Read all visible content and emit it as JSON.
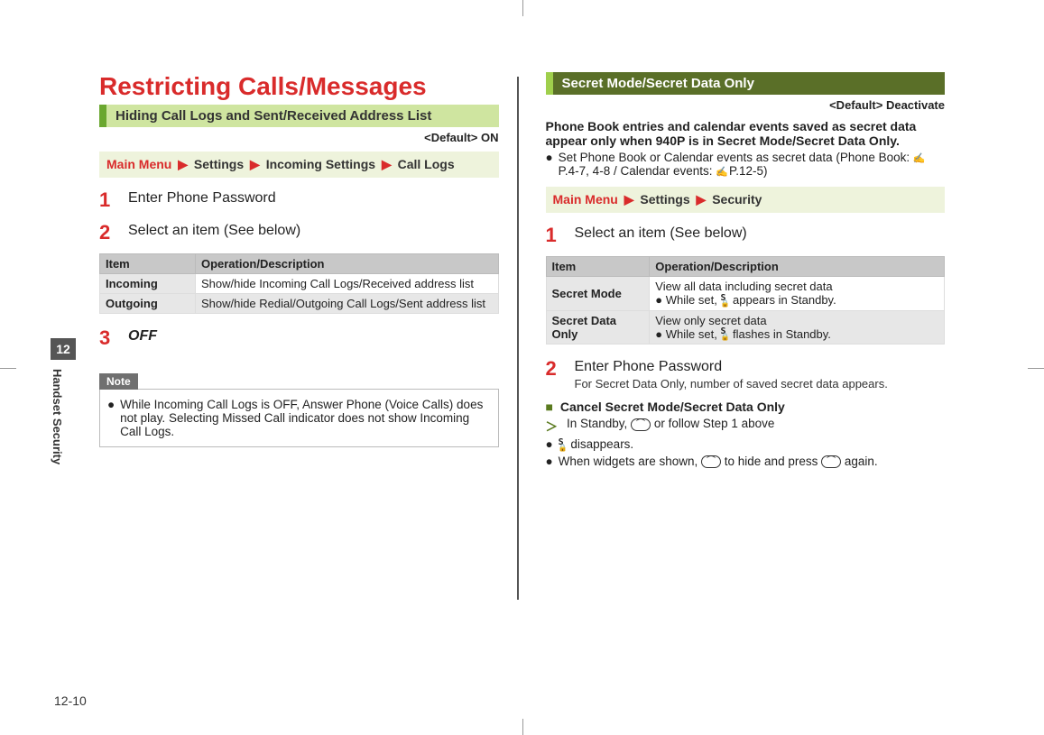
{
  "page": {
    "chapter_tab_num": "12",
    "chapter_tab_label": "Handset Security",
    "page_number": "12-10"
  },
  "left": {
    "title": "Restricting Calls/Messages",
    "subsection": "Hiding Call Logs and Sent/Received Address List",
    "default": "<Default> ON",
    "menu": {
      "main": "Main Menu",
      "a": "Settings",
      "b": "Incoming Settings",
      "c": "Call Logs"
    },
    "steps": [
      {
        "n": "1",
        "t": "Enter Phone Password"
      },
      {
        "n": "2",
        "t": "Select an item (See below)"
      },
      {
        "n": "3",
        "t": "OFF",
        "style": "off"
      }
    ],
    "table_head": {
      "c1": "Item",
      "c2": "Operation/Description"
    },
    "table_rows": [
      {
        "c1": "Incoming",
        "c2": "Show/hide Incoming Call Logs/Received address list"
      },
      {
        "c1": "Outgoing",
        "c2": "Show/hide Redial/Outgoing Call Logs/Sent address list"
      }
    ],
    "note_label": "Note",
    "note_body": "While Incoming Call Logs is OFF, Answer Phone (Voice Calls) does not play. Selecting Missed Call indicator does not show Incoming Call Logs."
  },
  "right": {
    "subsection": "Secret Mode/Secret Data Only",
    "default": "<Default> Deactivate",
    "para": "Phone Book entries and calendar events saved as secret data appear only when 940P is in Secret Mode/Secret Data Only.",
    "bullet1a": "Set Phone Book or Calendar events as secret data (Phone Book: ",
    "bullet1b": "P.4-7, 4-8 / Calendar events: ",
    "bullet1c": "P.12-5)",
    "menu": {
      "main": "Main Menu",
      "a": "Settings",
      "b": "Security"
    },
    "steps": [
      {
        "n": "1",
        "t": "Select an item (See below)"
      },
      {
        "n": "2",
        "t": "Enter Phone Password",
        "sub": "For Secret Data Only, number of saved secret data appears."
      }
    ],
    "table_head": {
      "c1": "Item",
      "c2": "Operation/Description"
    },
    "table_rows": [
      {
        "c1": "Secret Mode",
        "c2a": "View all data including secret data",
        "c2b": "While set, ",
        "c2c": " appears in Standby."
      },
      {
        "c1": "Secret Data Only",
        "c2a": "View only secret data",
        "c2b": "While set, ",
        "c2c": " flashes in Standby."
      }
    ],
    "cancel_title": "Cancel Secret Mode/Secret Data Only",
    "cancel_l1a": "In Standby, ",
    "cancel_l1b": " or follow Step 1 above",
    "cancel_l2": " disappears.",
    "cancel_l3a": "When widgets are shown, ",
    "cancel_l3b": " to hide and press ",
    "cancel_l3c": " again."
  }
}
